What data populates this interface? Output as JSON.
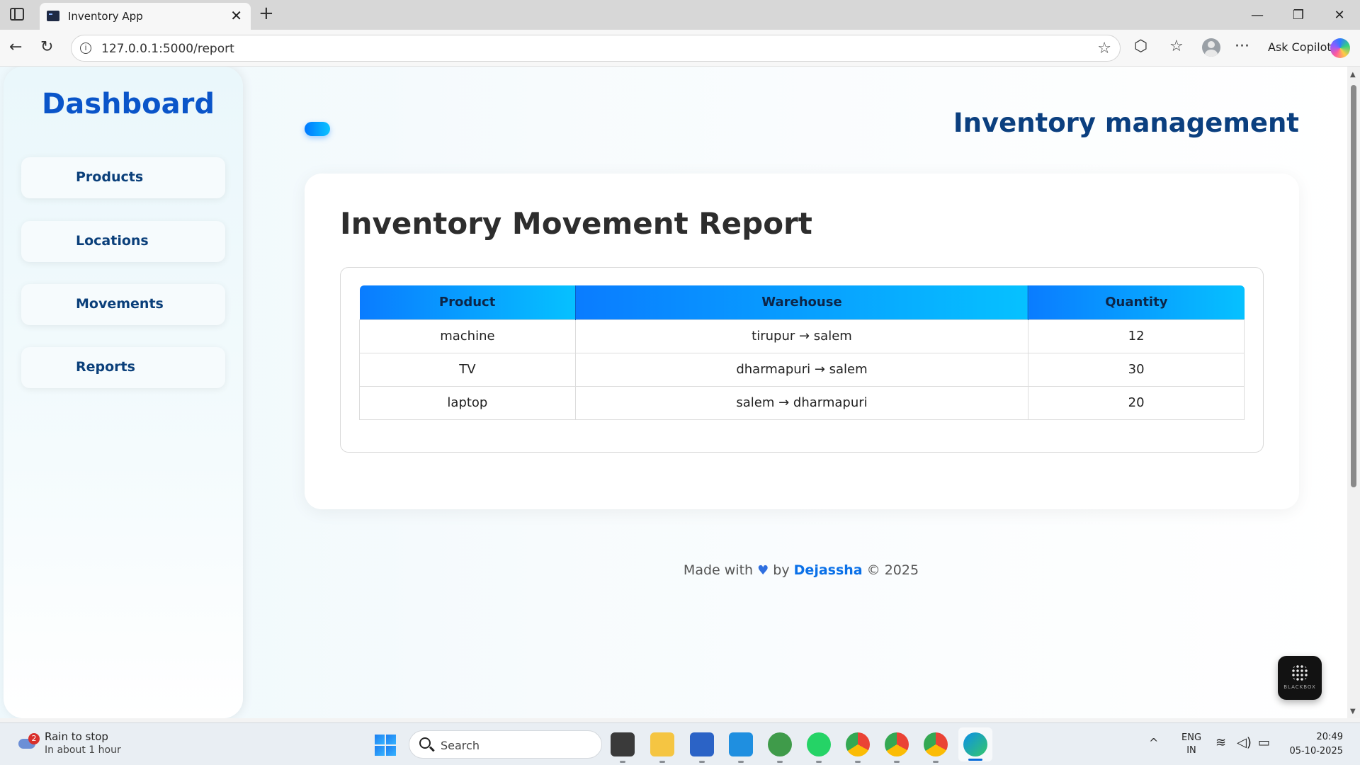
{
  "browser": {
    "tab_title": "Inventory App",
    "url": "127.0.0.1:5000/report",
    "copilot_label": "Ask Copilot"
  },
  "sidebar": {
    "title": "Dashboard",
    "items": [
      {
        "label": "Products"
      },
      {
        "label": "Locations"
      },
      {
        "label": "Movements"
      },
      {
        "label": "Reports"
      }
    ]
  },
  "header": {
    "title": "Inventory management"
  },
  "report": {
    "title": "Inventory Movement Report",
    "columns": [
      "Product",
      "Warehouse",
      "Quantity"
    ],
    "rows": [
      {
        "product": "machine",
        "warehouse": "tirupur → salem",
        "quantity": "12"
      },
      {
        "product": "TV",
        "warehouse": "dharmapuri → salem",
        "quantity": "30"
      },
      {
        "product": "laptop",
        "warehouse": "salem → dharmapuri",
        "quantity": "20"
      }
    ]
  },
  "footer": {
    "prefix": "Made with",
    "by": "by",
    "author": "Dejassha",
    "suffix": "© 2025"
  },
  "widget": {
    "label": "BLACKBOX"
  },
  "taskbar": {
    "weather_badge": "2",
    "weather_title": "Rain to stop",
    "weather_subtitle": "In about 1 hour",
    "search_placeholder": "Search",
    "language": "ENG",
    "region": "IN",
    "time": "20:49",
    "date": "05-10-2025"
  },
  "colors": {
    "accent": "#0a55c9",
    "table_header_start": "#0a7cff",
    "table_header_end": "#06c1ff",
    "heading": "#0b3f7f"
  }
}
